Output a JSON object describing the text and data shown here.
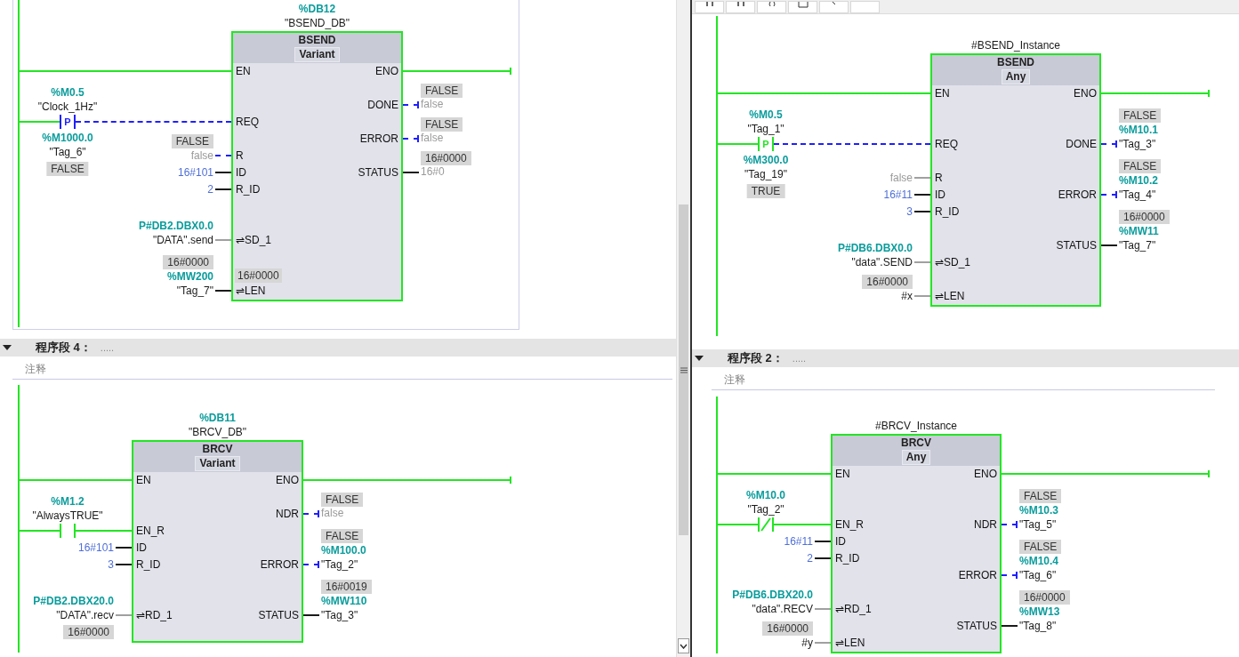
{
  "panels": [
    {
      "networks": [
        {
          "block": {
            "instance": [
              {
                "kind": "address",
                "text": "%DB12"
              },
              {
                "kind": "tag",
                "text": "\"BSEND_DB\""
              }
            ],
            "name": "BSEND",
            "type": "Variant",
            "inputs": [
              {
                "pin": "EN",
                "kind": "green"
              },
              {
                "pin": "REQ",
                "kind": "dashed-blue",
                "contact": {
                  "kind": "p",
                  "symbol": "P",
                  "powered": false,
                  "above": [
                    {
                      "kind": "address",
                      "text": "%M0.5"
                    },
                    {
                      "kind": "tag",
                      "text": "\"Clock_1Hz\""
                    }
                  ],
                  "below": [
                    {
                      "kind": "address",
                      "text": "%M1000.0"
                    },
                    {
                      "kind": "tag",
                      "text": "\"Tag_6\""
                    },
                    {
                      "kind": "monitor",
                      "text": "FALSE"
                    }
                  ]
                }
              },
              {
                "pin": "R",
                "kind": "dashed-blue",
                "lines": [
                  {
                    "kind": "monitor",
                    "text": "FALSE"
                  },
                  {
                    "kind": "default",
                    "text": "false"
                  }
                ]
              },
              {
                "pin": "ID",
                "kind": "black",
                "lines": [
                  {
                    "kind": "constant",
                    "text": "16#101"
                  }
                ]
              },
              {
                "pin": "R_ID",
                "kind": "black",
                "lines": [
                  {
                    "kind": "constant",
                    "text": "2"
                  }
                ]
              },
              {
                "pin": "⇌SD_1",
                "inout": true,
                "kind": "grey",
                "lines": [
                  {
                    "kind": "address",
                    "text": "P#DB2.DBX0.0"
                  },
                  {
                    "kind": "tag",
                    "text": "\"DATA\".send"
                  }
                ]
              },
              {
                "pin": "⇌LEN",
                "inout": true,
                "kind": "black",
                "inner": "16#0000",
                "lines": [
                  {
                    "kind": "monitor",
                    "text": "16#0000"
                  },
                  {
                    "kind": "address",
                    "text": "%MW200"
                  },
                  {
                    "kind": "tag",
                    "text": "\"Tag_7\""
                  }
                ]
              }
            ],
            "outputs": [
              {
                "pin": "ENO",
                "kind": "green"
              },
              {
                "pin": "DONE",
                "kind": "dashed-blue",
                "lines": [
                  {
                    "kind": "monitor",
                    "text": "FALSE"
                  },
                  {
                    "kind": "default",
                    "text": "false"
                  }
                ]
              },
              {
                "pin": "ERROR",
                "kind": "dashed-blue",
                "lines": [
                  {
                    "kind": "monitor",
                    "text": "FALSE"
                  },
                  {
                    "kind": "default",
                    "text": "false"
                  }
                ]
              },
              {
                "pin": "STATUS",
                "kind": "black",
                "lines": [
                  {
                    "kind": "monitor",
                    "text": "16#0000"
                  },
                  {
                    "kind": "default",
                    "text": "16#0"
                  }
                ]
              }
            ]
          }
        },
        {
          "title": "程序段 4：",
          "title_text": ".....",
          "comment": "注释",
          "block": {
            "instance": [
              {
                "kind": "address",
                "text": "%DB11"
              },
              {
                "kind": "tag",
                "text": "\"BRCV_DB\""
              }
            ],
            "name": "BRCV",
            "type": "Variant",
            "inputs": [
              {
                "pin": "EN",
                "kind": "green"
              },
              {
                "pin": "EN_R",
                "kind": "green",
                "contact": {
                  "kind": "no",
                  "powered": true,
                  "above": [
                    {
                      "kind": "address",
                      "text": "%M1.2"
                    },
                    {
                      "kind": "tag",
                      "text": "\"AlwaysTRUE\""
                    }
                  ]
                }
              },
              {
                "pin": "ID",
                "kind": "black",
                "lines": [
                  {
                    "kind": "constant",
                    "text": "16#101"
                  }
                ]
              },
              {
                "pin": "R_ID",
                "kind": "black",
                "lines": [
                  {
                    "kind": "constant",
                    "text": "3"
                  }
                ]
              },
              {
                "pin": "⇌RD_1",
                "inout": true,
                "kind": "grey",
                "lines": [
                  {
                    "kind": "address",
                    "text": "P#DB2.DBX20.0"
                  },
                  {
                    "kind": "tag",
                    "text": "\"DATA\".recv"
                  }
                ]
              },
              {
                "inout": true,
                "lines": [
                  {
                    "kind": "monitor",
                    "text": "16#0000"
                  }
                ]
              }
            ],
            "outputs": [
              {
                "pin": "ENO",
                "kind": "green"
              },
              {
                "pin": "NDR",
                "kind": "dashed-blue",
                "lines": [
                  {
                    "kind": "monitor",
                    "text": "FALSE"
                  },
                  {
                    "kind": "default",
                    "text": "false"
                  }
                ]
              },
              {
                "pin": "ERROR",
                "kind": "dashed-blue",
                "lines": [
                  {
                    "kind": "monitor",
                    "text": "FALSE"
                  },
                  {
                    "kind": "address",
                    "text": "%M100.0"
                  },
                  {
                    "kind": "tag",
                    "text": "\"Tag_2\""
                  }
                ]
              },
              {
                "pin": "STATUS",
                "kind": "black",
                "lines": [
                  {
                    "kind": "monitor",
                    "text": "16#0019"
                  },
                  {
                    "kind": "address",
                    "text": "%MW110"
                  },
                  {
                    "kind": "tag",
                    "text": "\"Tag_3\""
                  }
                ]
              }
            ]
          }
        }
      ]
    },
    {
      "networks": [
        {
          "block": {
            "instance": [
              {
                "kind": "tag",
                "text": "#BSEND_Instance"
              }
            ],
            "name": "BSEND",
            "type": "Any",
            "inputs": [
              {
                "pin": "EN",
                "kind": "green"
              },
              {
                "pin": "REQ",
                "kind": "dashed-blue",
                "contact": {
                  "kind": "p",
                  "symbol": "P",
                  "powered": true,
                  "above": [
                    {
                      "kind": "address",
                      "text": "%M0.5"
                    },
                    {
                      "kind": "tag",
                      "text": "\"Tag_1\""
                    }
                  ],
                  "below": [
                    {
                      "kind": "address",
                      "text": "%M300.0"
                    },
                    {
                      "kind": "tag",
                      "text": "\"Tag_19\""
                    },
                    {
                      "kind": "monitor",
                      "text": "TRUE"
                    }
                  ]
                }
              },
              {
                "pin": "R",
                "kind": "grey",
                "lines": [
                  {
                    "kind": "default",
                    "text": "false"
                  }
                ]
              },
              {
                "pin": "ID",
                "kind": "black",
                "lines": [
                  {
                    "kind": "constant",
                    "text": "16#11"
                  }
                ]
              },
              {
                "pin": "R_ID",
                "kind": "black",
                "lines": [
                  {
                    "kind": "constant",
                    "text": "3"
                  }
                ]
              },
              {
                "pin": "⇌SD_1",
                "inout": true,
                "kind": "grey",
                "lines": [
                  {
                    "kind": "address",
                    "text": "P#DB6.DBX0.0"
                  },
                  {
                    "kind": "tag",
                    "text": "\"data\".SEND"
                  }
                ]
              },
              {
                "pin": "⇌LEN",
                "inout": true,
                "kind": "grey",
                "lines": [
                  {
                    "kind": "monitor",
                    "text": "16#0000"
                  },
                  {
                    "kind": "tag",
                    "text": "#x"
                  }
                ]
              }
            ],
            "outputs": [
              {
                "pin": "ENO",
                "kind": "green"
              },
              {
                "pin": "DONE",
                "kind": "dashed-blue",
                "lines": [
                  {
                    "kind": "monitor",
                    "text": "FALSE"
                  },
                  {
                    "kind": "address",
                    "text": "%M10.1"
                  },
                  {
                    "kind": "tag",
                    "text": "\"Tag_3\""
                  }
                ]
              },
              {
                "pin": "ERROR",
                "kind": "dashed-blue",
                "lines": [
                  {
                    "kind": "monitor",
                    "text": "FALSE"
                  },
                  {
                    "kind": "address",
                    "text": "%M10.2"
                  },
                  {
                    "kind": "tag",
                    "text": "\"Tag_4\""
                  }
                ]
              },
              {
                "pin": "STATUS",
                "kind": "black",
                "lines": [
                  {
                    "kind": "monitor",
                    "text": "16#0000"
                  },
                  {
                    "kind": "address",
                    "text": "%MW11"
                  },
                  {
                    "kind": "tag",
                    "text": "\"Tag_7\""
                  }
                ]
              }
            ]
          }
        },
        {
          "title": "程序段 2：",
          "title_text": ".....",
          "comment": "注释",
          "block": {
            "instance": [
              {
                "kind": "tag",
                "text": "#BRCV_Instance"
              }
            ],
            "name": "BRCV",
            "type": "Any",
            "inputs": [
              {
                "pin": "EN",
                "kind": "green"
              },
              {
                "pin": "EN_R",
                "kind": "green",
                "contact": {
                  "kind": "nc",
                  "powered": true,
                  "above": [
                    {
                      "kind": "address",
                      "text": "%M10.0"
                    },
                    {
                      "kind": "tag",
                      "text": "\"Tag_2\""
                    }
                  ]
                }
              },
              {
                "pin": "ID",
                "kind": "black",
                "lines": [
                  {
                    "kind": "constant",
                    "text": "16#11"
                  }
                ]
              },
              {
                "pin": "R_ID",
                "kind": "black",
                "lines": [
                  {
                    "kind": "constant",
                    "text": "2"
                  }
                ]
              },
              {
                "pin": "⇌RD_1",
                "inout": true,
                "kind": "grey",
                "lines": [
                  {
                    "kind": "address",
                    "text": "P#DB6.DBX20.0"
                  },
                  {
                    "kind": "tag",
                    "text": "\"data\".RECV"
                  }
                ]
              },
              {
                "pin": "⇌LEN",
                "inout": true,
                "kind": "grey",
                "lines": [
                  {
                    "kind": "monitor",
                    "text": "16#0000"
                  },
                  {
                    "kind": "tag",
                    "text": "#y"
                  }
                ]
              }
            ],
            "outputs": [
              {
                "pin": "ENO",
                "kind": "green"
              },
              {
                "pin": "NDR",
                "kind": "dashed-blue",
                "lines": [
                  {
                    "kind": "monitor",
                    "text": "FALSE"
                  },
                  {
                    "kind": "address",
                    "text": "%M10.3"
                  },
                  {
                    "kind": "tag",
                    "text": "\"Tag_5\""
                  }
                ]
              },
              {
                "pin": "ERROR",
                "kind": "dashed-blue",
                "lines": [
                  {
                    "kind": "monitor",
                    "text": "FALSE"
                  },
                  {
                    "kind": "address",
                    "text": "%M10.4"
                  },
                  {
                    "kind": "tag",
                    "text": "\"Tag_6\""
                  }
                ]
              },
              {
                "pin": "STATUS",
                "kind": "black",
                "lines": [
                  {
                    "kind": "monitor",
                    "text": "16#0000"
                  },
                  {
                    "kind": "address",
                    "text": "%MW13"
                  },
                  {
                    "kind": "tag",
                    "text": "\"Tag_8\""
                  }
                ]
              }
            ]
          }
        }
      ]
    }
  ]
}
